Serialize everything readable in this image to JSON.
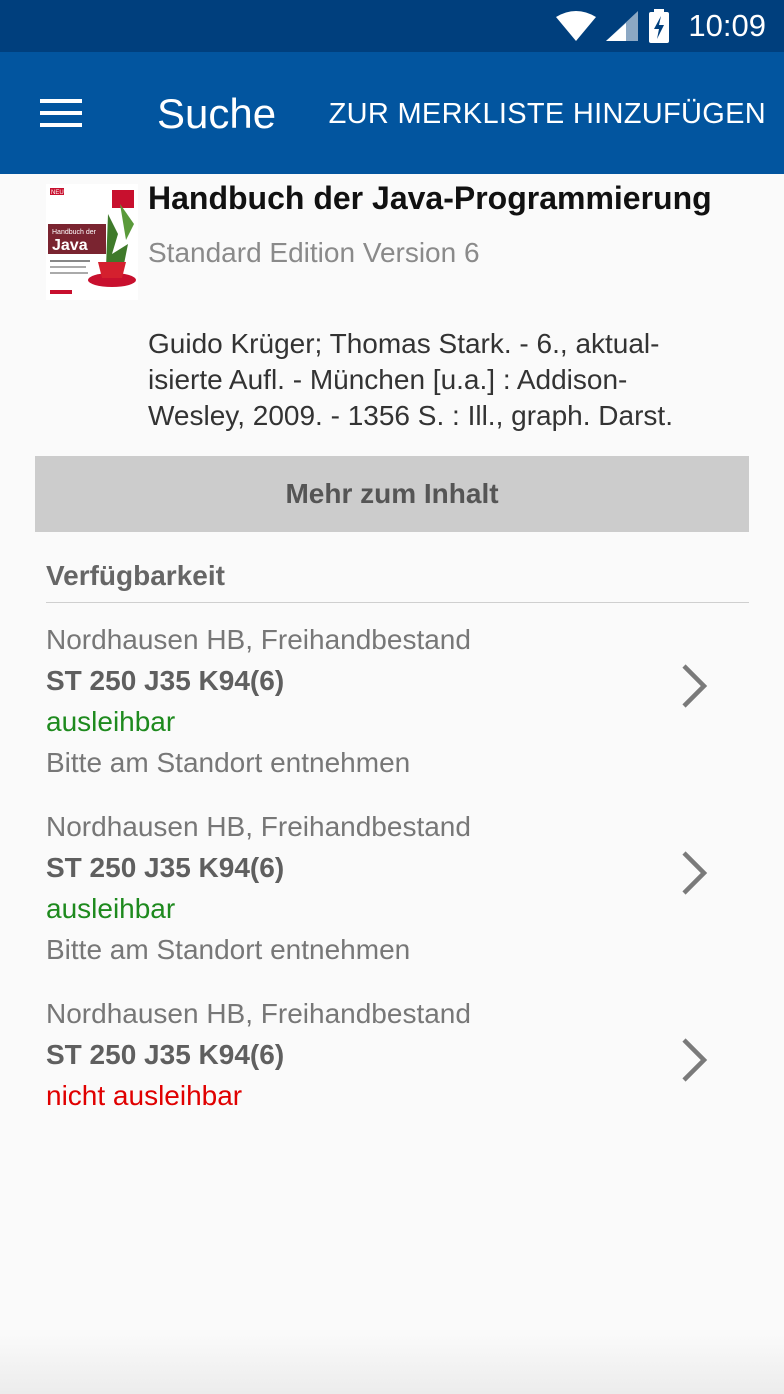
{
  "status_bar": {
    "time": "10:09"
  },
  "app_bar": {
    "title": "Suche",
    "action_label": "ZUR MERKLISTE HINZUFÜGEN"
  },
  "book": {
    "title": "Handbuch der Java-Programmierung",
    "subtitle": "Standard Edition Version 6",
    "description_lines": [
      "Guido Krüger; Thomas Stark. - 6., aktual-",
      "isierte Aufl. - München [u.a.] : Addison-",
      "Wesley, 2009. - 1356 S. : Ill., graph. Darst."
    ],
    "cover_text": {
      "badge": "NEU",
      "title_line1": "Handbuch der",
      "title_line2": "Java"
    }
  },
  "more_button": {
    "label": "Mehr zum Inhalt"
  },
  "availability": {
    "heading": "Verfügbarkeit",
    "items": [
      {
        "location": "Nordhausen HB, Freihandbestand",
        "signature": "ST 250 J35 K94(6)",
        "status": "ausleihbar",
        "status_color": "#1e8a1e",
        "note": "Bitte am Standort entnehmen"
      },
      {
        "location": "Nordhausen HB, Freihandbestand",
        "signature": "ST 250 J35 K94(6)",
        "status": "ausleihbar",
        "status_color": "#1e8a1e",
        "note": "Bitte am Standort entnehmen"
      },
      {
        "location": "Nordhausen HB, Freihandbestand",
        "signature": "ST 250 J35 K94(6)",
        "status": "nicht ausleihbar",
        "status_color": "#e00000"
      }
    ]
  },
  "colors": {
    "status_bar": "#003f7d",
    "app_bar": "#02559f"
  }
}
